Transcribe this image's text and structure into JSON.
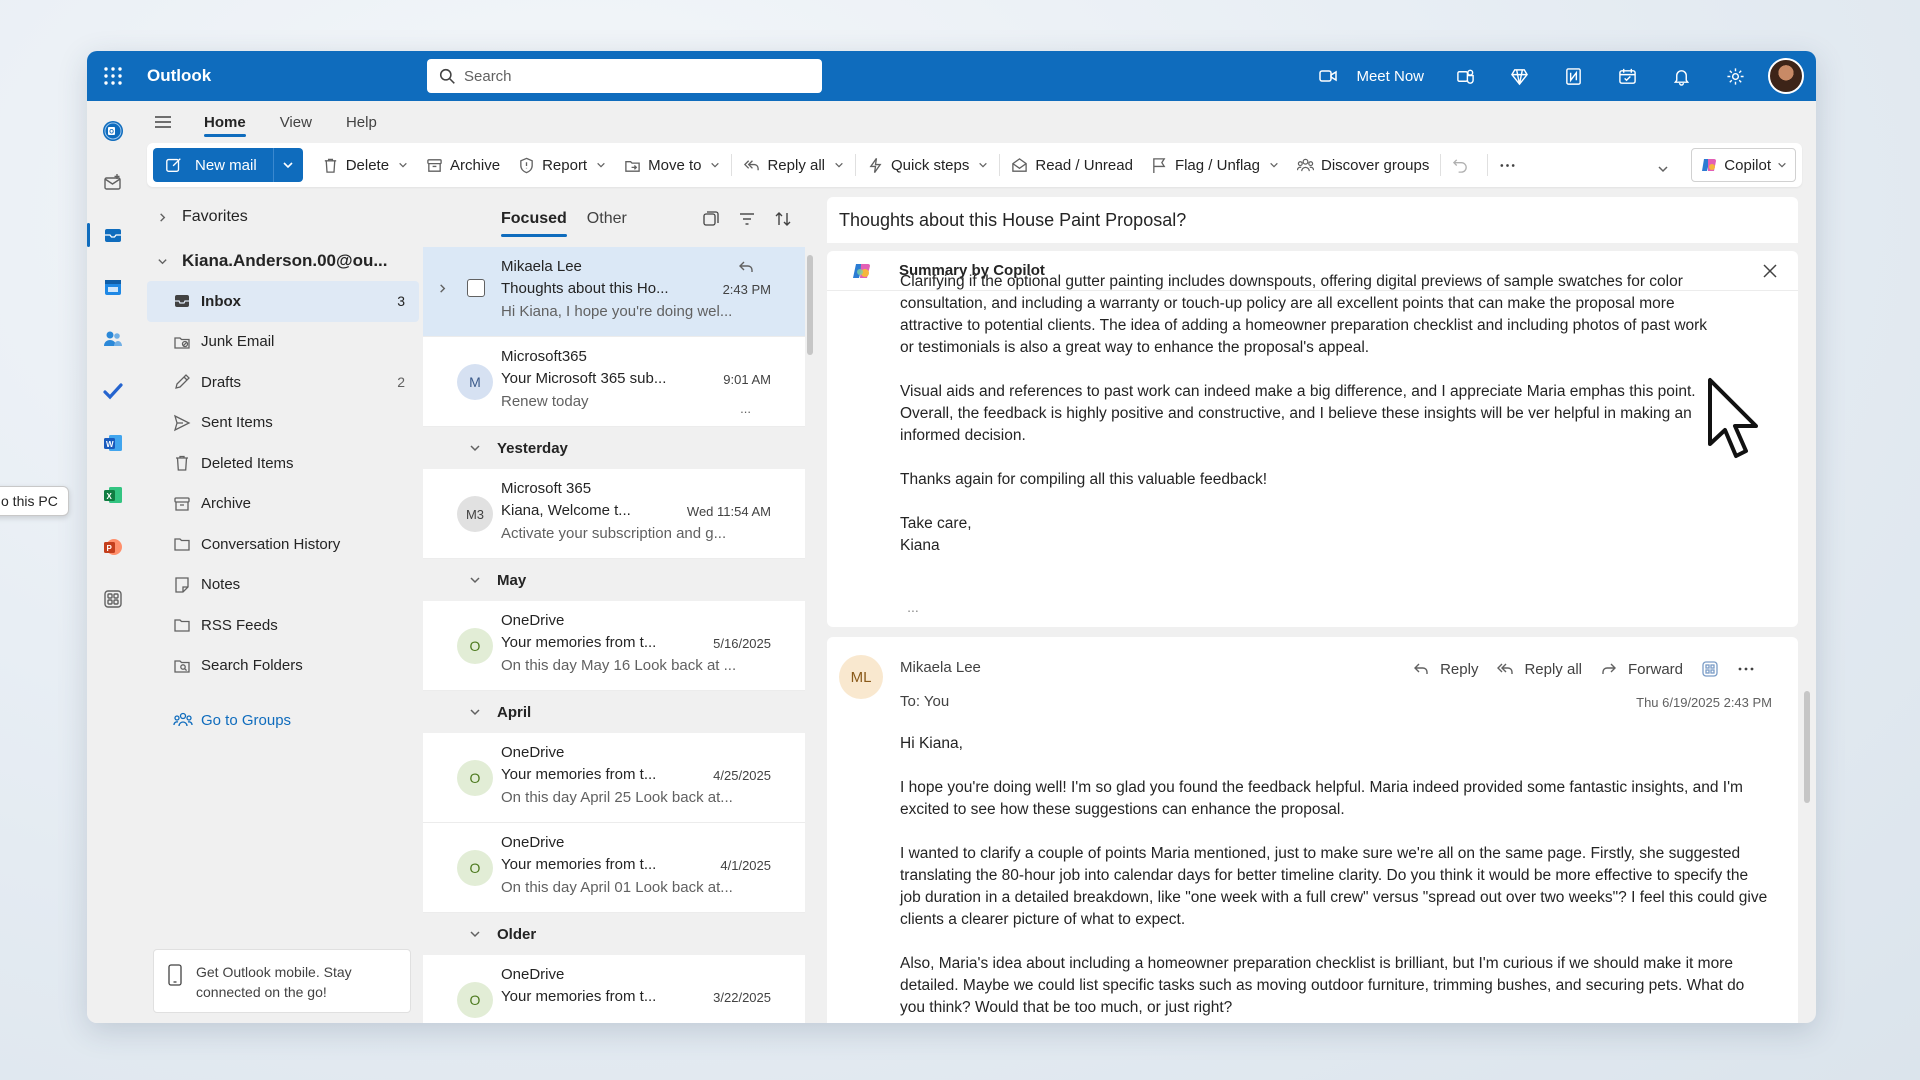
{
  "app": {
    "name": "Outlook"
  },
  "search": {
    "placeholder": "Search"
  },
  "titlebar": {
    "meet_now": "Meet Now"
  },
  "tabs": [
    {
      "label": "Home",
      "active": true
    },
    {
      "label": "View"
    },
    {
      "label": "Help"
    }
  ],
  "ribbon": {
    "new_mail": "New mail",
    "delete": "Delete",
    "archive": "Archive",
    "report": "Report",
    "move_to": "Move to",
    "reply_all": "Reply all",
    "quick_steps": "Quick steps",
    "read_unread": "Read / Unread",
    "flag_unflag": "Flag / Unflag",
    "discover_groups": "Discover groups",
    "copilot": "Copilot"
  },
  "folders": {
    "favorites": "Favorites",
    "account": "Kiana.Anderson.00@ou...",
    "items": [
      {
        "name": "Inbox",
        "count": "3",
        "icon": "inbox-icon"
      },
      {
        "name": "Junk Email",
        "count": "",
        "icon": "junk-icon"
      },
      {
        "name": "Drafts",
        "count": "2",
        "icon": "drafts-icon"
      },
      {
        "name": "Sent Items",
        "count": "",
        "icon": "send-icon"
      },
      {
        "name": "Deleted Items",
        "count": "",
        "icon": "trash-icon"
      },
      {
        "name": "Archive",
        "count": "",
        "icon": "archive-icon"
      },
      {
        "name": "Conversation History",
        "count": "",
        "icon": "folder-icon"
      },
      {
        "name": "Notes",
        "count": "",
        "icon": "notes-icon"
      },
      {
        "name": "RSS Feeds",
        "count": "",
        "icon": "folder-icon"
      },
      {
        "name": "Search Folders",
        "count": "",
        "icon": "search-folder-icon"
      }
    ],
    "go_to_groups": "Go to Groups",
    "mobile_promo": "Get Outlook mobile. Stay connected on the go!"
  },
  "message_list": {
    "pivots": [
      "Focused",
      "Other"
    ],
    "items_top": [
      {
        "sender": "Mikaela Lee",
        "subject": "Thoughts about this Ho...",
        "time": "2:43 PM",
        "preview": "Hi Kiana, I hope you're doing wel..."
      },
      {
        "sender": "Microsoft365",
        "subject": "Your Microsoft 365 sub...",
        "time": "9:01 AM",
        "preview": "Renew today",
        "initials": "M"
      }
    ],
    "groups": {
      "yesterday": "Yesterday",
      "may": "May",
      "april": "April",
      "older": "Older"
    },
    "yesterday_items": [
      {
        "sender": "Microsoft 365",
        "subject": "Kiana, Welcome t...",
        "time": "Wed 11:54 AM",
        "preview": "Activate your subscription and g...",
        "initials": "M3"
      }
    ],
    "may_items": [
      {
        "sender": "OneDrive",
        "subject": "Your memories from t...",
        "time": "5/16/2025",
        "preview": "On this day May 16 Look back at ...",
        "initials": "O"
      }
    ],
    "april_items": [
      {
        "sender": "OneDrive",
        "subject": "Your memories from t...",
        "time": "4/25/2025",
        "preview": "On this day April 25 Look back at...",
        "initials": "O"
      },
      {
        "sender": "OneDrive",
        "subject": "Your memories from t...",
        "time": "4/1/2025",
        "preview": "On this day April 01 Look back at...",
        "initials": "O"
      }
    ],
    "older_items": [
      {
        "sender": "OneDrive",
        "subject": "Your memories from t...",
        "time": "3/22/2025",
        "preview": "",
        "initials": "O"
      }
    ]
  },
  "reading": {
    "subject": "Thoughts about this House Paint Proposal?",
    "copilot_title": "Summary by Copilot",
    "copilot_paragraphs": [
      "Clarifying if the optional gutter painting includes downspouts, offering digital previews of sample swatches for color consultation, and including a warranty or touch-up policy are all excellent points that can make the proposal more attractive to potential clients. The idea of adding a homeowner preparation checklist and including photos of past work or testimonials is also a great way to enhance the proposal's appeal.",
      "Visual aids and references to past work can indeed make a big difference, and I appreciate Maria emphas this point. Overall, the feedback is highly positive and constructive, and I believe these insights will be ver helpful in making an informed decision.",
      "Thanks again for compiling all this valuable feedback!",
      "Take care,\nKiana"
    ],
    "copilot_ellipsis": "...",
    "mail": {
      "initials": "ML",
      "from": "Mikaela Lee",
      "to": "To: You",
      "date": "Thu 6/19/2025 2:43 PM",
      "reply": "Reply",
      "reply_all": "Reply all",
      "forward": "Forward",
      "paragraphs": [
        "Hi Kiana,",
        "I hope you're doing well! I'm so glad you found the feedback helpful. Maria indeed provided some fantastic insights, and I'm excited to see how these suggestions can enhance the proposal.",
        "I wanted to clarify a couple of points Maria mentioned, just to make sure we're all on the same page. Firstly, she suggested translating the 80-hour job into calendar days for better timeline clarity. Do you think it would be more effective to specify the job duration in a detailed breakdown, like \"one week with a full crew\" versus \"spread out over two weeks\"? I feel this could give clients a clearer picture of what to expect.",
        "Also, Maria's idea about including a homeowner preparation checklist is brilliant, but I'm curious if we should make it more detailed. Maybe we could list specific tasks such as moving outdoor furniture, trimming bushes, and securing pets. What do you think? Would that be too much, or just right?"
      ]
    }
  },
  "tooltip": "o this PC",
  "colors": {
    "brand": "#0f6cbd",
    "selected": "#dbe8f6"
  }
}
